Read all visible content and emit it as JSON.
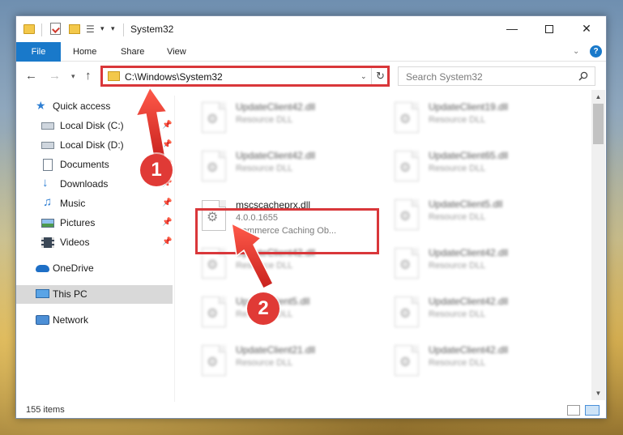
{
  "window": {
    "title": "System32",
    "controls": {
      "minimize": "—",
      "close": "✕"
    }
  },
  "ribbon": {
    "tabs": [
      {
        "label": "File"
      },
      {
        "label": "Home"
      },
      {
        "label": "Share"
      },
      {
        "label": "View"
      }
    ],
    "help": "?"
  },
  "nav": {
    "address": "C:\\Windows\\System32",
    "search_placeholder": "Search System32"
  },
  "sidebar": {
    "items": [
      {
        "label": "Quick access",
        "icon": "star-icon"
      },
      {
        "label": "Local Disk (C:)",
        "icon": "drive-icon",
        "pinned": true
      },
      {
        "label": "Local Disk (D:)",
        "icon": "drive-icon",
        "pinned": true
      },
      {
        "label": "Documents",
        "icon": "documents-icon",
        "pinned": true
      },
      {
        "label": "Downloads",
        "icon": "downloads-icon",
        "pinned": true
      },
      {
        "label": "Music",
        "icon": "music-icon",
        "pinned": true
      },
      {
        "label": "Pictures",
        "icon": "pictures-icon",
        "pinned": true
      },
      {
        "label": "Videos",
        "icon": "videos-icon",
        "pinned": true
      },
      {
        "label": "OneDrive",
        "icon": "onedrive-icon"
      },
      {
        "label": "This PC",
        "icon": "computer-icon",
        "selected": true
      },
      {
        "label": "Network",
        "icon": "network-icon"
      }
    ]
  },
  "files": {
    "left": [
      {
        "name": "UpdateClient42.dll",
        "type": "Resource DLL"
      },
      {
        "name": "UpdateClient42.dll",
        "type": "Resource DLL"
      },
      {
        "name": "mscscacheprx.dll",
        "version": "4.0.0.1655",
        "description": "Commerce Caching Ob..."
      },
      {
        "name": "UpdateClient42.dll",
        "type": "Resource DLL"
      },
      {
        "name": "UpdateClient5.dll",
        "type": "Resource DLL"
      },
      {
        "name": "UpdateClient21.dll",
        "type": "Resource DLL"
      }
    ],
    "right": [
      {
        "name": "UpdateClient19.dll",
        "type": "Resource DLL"
      },
      {
        "name": "UpdateClient65.dll",
        "type": "Resource DLL"
      },
      {
        "name": "UpdateClient5.dll",
        "type": "Resource DLL"
      },
      {
        "name": "UpdateClient42.dll",
        "type": "Resource DLL"
      },
      {
        "name": "UpdateClient42.dll",
        "type": "Resource DLL"
      },
      {
        "name": "UpdateClient42.dll",
        "type": "Resource DLL"
      }
    ]
  },
  "status": {
    "items_count": "155 items"
  },
  "annotations": {
    "badge_1": "1",
    "badge_2": "2",
    "color": "#e03a36"
  },
  "colors": {
    "accent": "#1979ca",
    "highlight": "#d9373a"
  }
}
